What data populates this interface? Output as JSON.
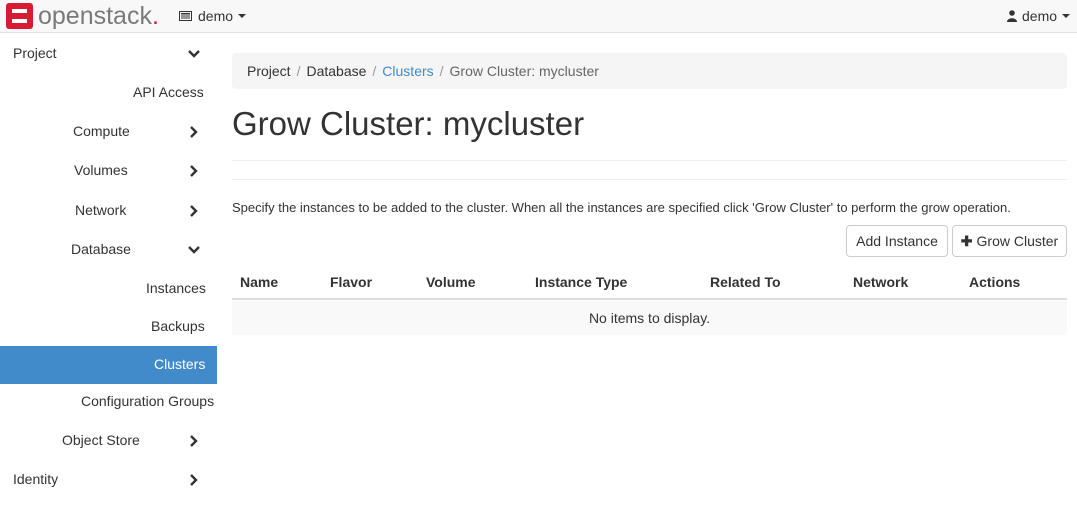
{
  "brand": {
    "name": "openstack",
    "suffix": "."
  },
  "topbar": {
    "project_label": "demo",
    "user_label": "demo"
  },
  "sidebar": {
    "items": [
      {
        "label": "Project",
        "chevron": "down"
      },
      {
        "label": "API Access"
      },
      {
        "label": "Compute",
        "chevron": "right"
      },
      {
        "label": "Volumes",
        "chevron": "right"
      },
      {
        "label": "Network",
        "chevron": "right"
      },
      {
        "label": "Database",
        "chevron": "down"
      },
      {
        "label": "Instances"
      },
      {
        "label": "Backups"
      },
      {
        "label": "Clusters",
        "active": true
      },
      {
        "label": "Configuration Groups"
      },
      {
        "label": "Object Store",
        "chevron": "right"
      },
      {
        "label": "Identity",
        "chevron": "right"
      }
    ]
  },
  "breadcrumb": {
    "items": [
      "Project",
      "Database",
      "Clusters",
      "Grow Cluster: mycluster"
    ],
    "separator": "/"
  },
  "page": {
    "title": "Grow Cluster: mycluster",
    "help_text": "Specify the instances to be added to the cluster. When all the instances are specified click 'Grow Cluster' to perform the grow operation."
  },
  "actions": {
    "add_instance": "Add Instance",
    "grow_cluster": "Grow Cluster"
  },
  "table": {
    "columns": [
      "Name",
      "Flavor",
      "Volume",
      "Instance Type",
      "Related To",
      "Network",
      "Actions"
    ],
    "empty_text": "No items to display."
  },
  "colors": {
    "brand_red": "#da1a32",
    "active_bg": "#428bca",
    "link": "#428bca"
  }
}
